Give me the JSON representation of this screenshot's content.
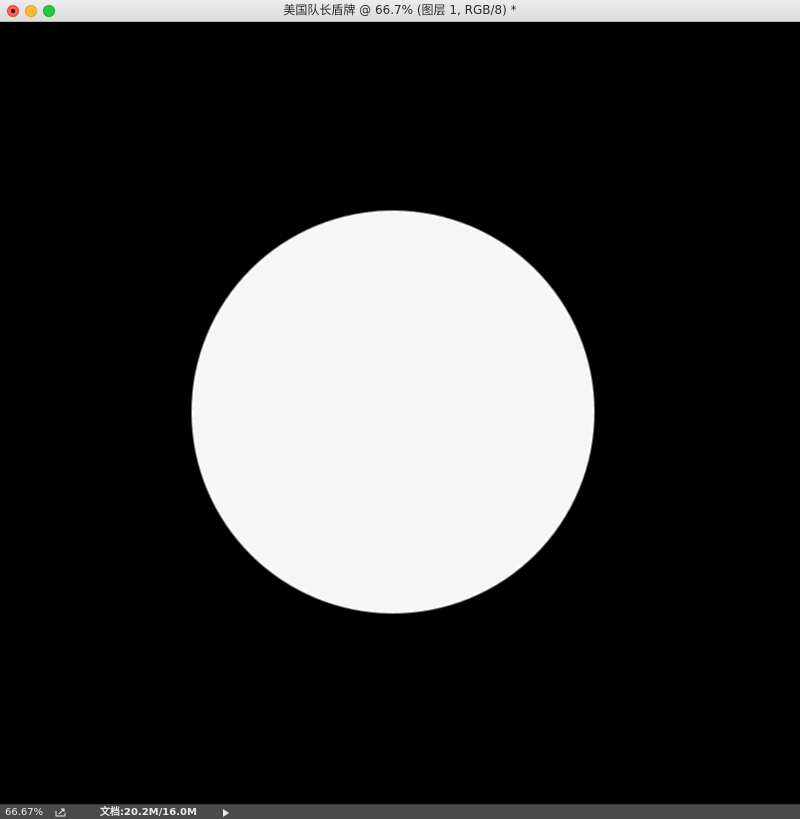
{
  "window": {
    "title": "美国队长盾牌 @ 66.7% (图层 1, RGB/8) *"
  },
  "canvas": {
    "background_color": "#000000",
    "shape_fill_color": "#f6f6f6"
  },
  "statusbar": {
    "zoom": "66.67%",
    "doc_info": "文档:20.2M/16.0M"
  },
  "icons": {
    "share": "share-icon",
    "menu_arrow": "play-arrow-icon"
  }
}
